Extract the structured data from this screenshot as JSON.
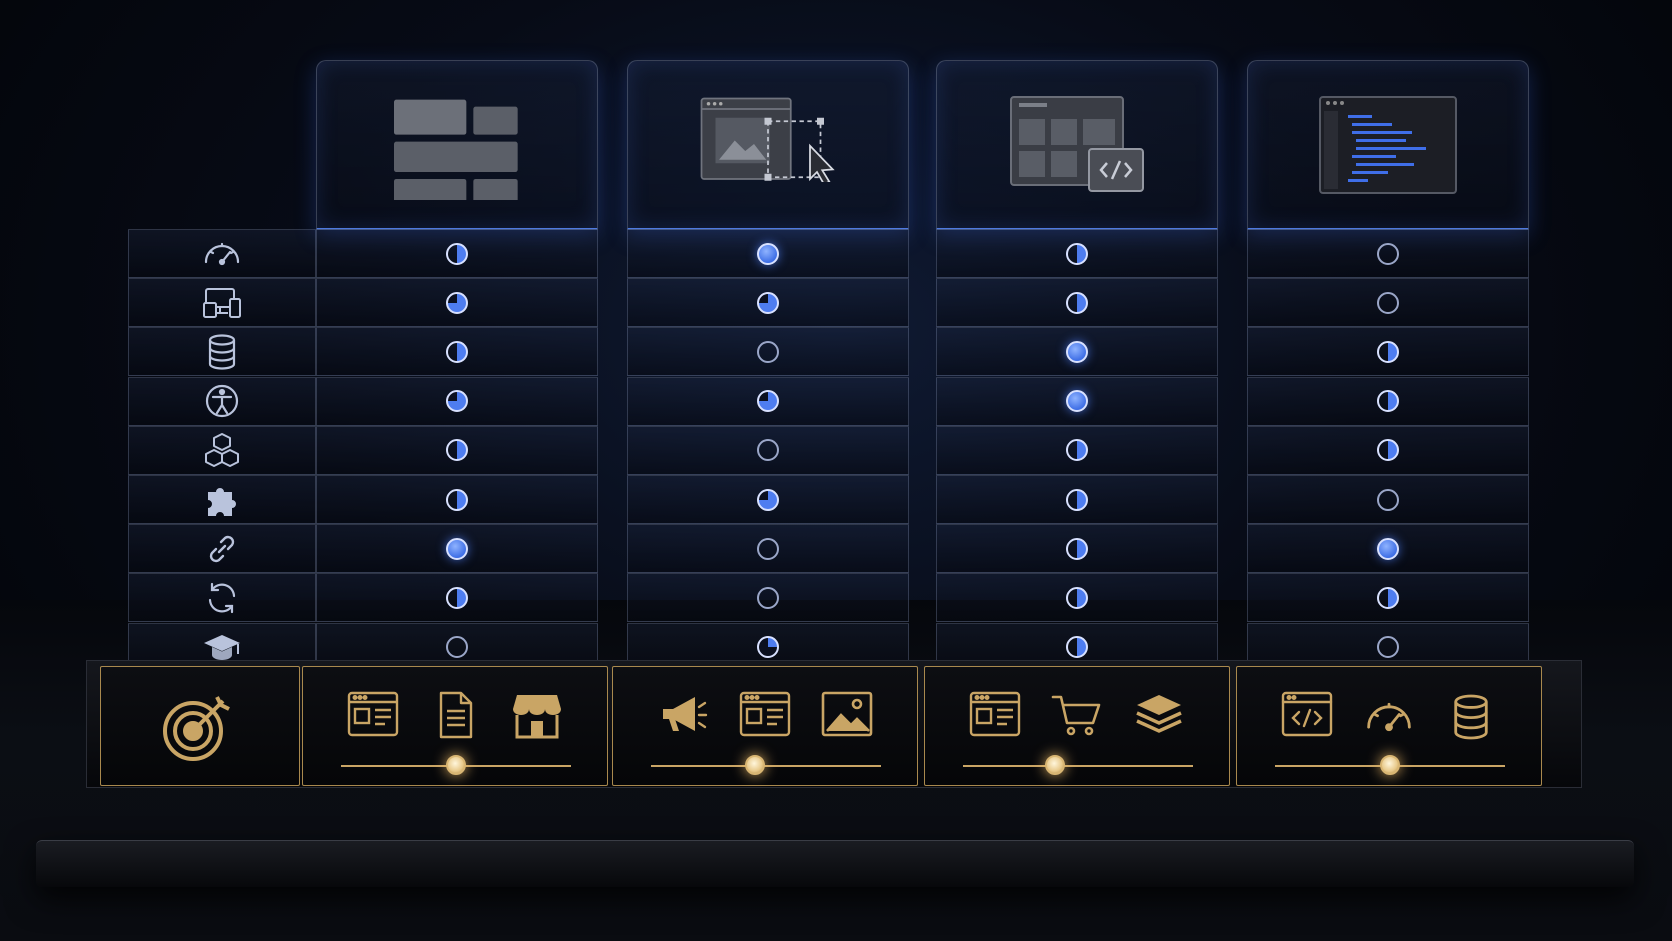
{
  "colors": {
    "accent_blue": "#4e7df0",
    "gold": "#c9a565",
    "background": "#070b16"
  },
  "columns": [
    {
      "name": "column-1",
      "header_icon": "layout-blocks-icon",
      "ratings": [
        "half",
        "three",
        "half",
        "three",
        "half",
        "half",
        "full",
        "half",
        "empty"
      ],
      "footer_icons": [
        "browser-window-icon",
        "document-icon",
        "storefront-icon"
      ],
      "slider_value": 0.5
    },
    {
      "name": "column-2",
      "header_icon": "image-select-cursor-icon",
      "ratings": [
        "full",
        "three",
        "empty",
        "three",
        "empty",
        "three",
        "empty",
        "empty",
        "quarter"
      ],
      "footer_icons": [
        "megaphone-icon",
        "browser-window-icon",
        "image-icon"
      ],
      "slider_value": 0.45
    },
    {
      "name": "column-3",
      "header_icon": "dashboard-code-icon",
      "ratings": [
        "half",
        "half",
        "full",
        "full",
        "half",
        "half",
        "half",
        "half",
        "half"
      ],
      "footer_icons": [
        "browser-window-icon",
        "shopping-cart-icon",
        "layers-icon"
      ],
      "slider_value": 0.4
    },
    {
      "name": "column-4",
      "header_icon": "code-editor-icon",
      "ratings": [
        "empty",
        "empty",
        "half",
        "half",
        "half",
        "empty",
        "full",
        "half",
        "empty"
      ],
      "footer_icons": [
        "code-window-icon",
        "speedometer-icon",
        "database-icon"
      ],
      "slider_value": 0.5
    }
  ],
  "rows": [
    "speedometer-icon",
    "devices-icon",
    "database-icon",
    "accessibility-icon",
    "cubes-icon",
    "puzzle-piece-icon",
    "link-icon",
    "refresh-icon",
    "graduation-cap-icon"
  ],
  "goal_icon": "target-arrow-icon"
}
